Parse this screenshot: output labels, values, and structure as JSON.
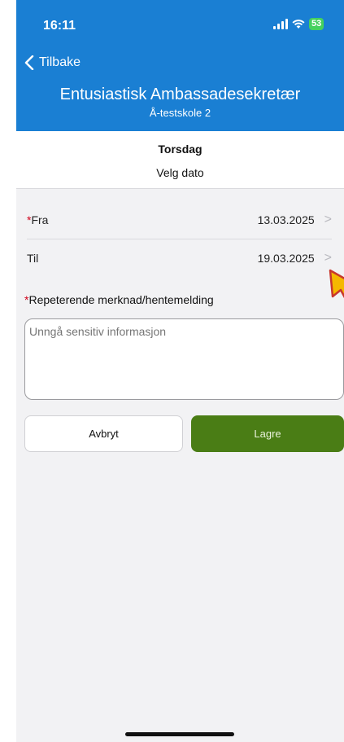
{
  "status_bar": {
    "time": "16:11",
    "battery": "53"
  },
  "header": {
    "back_label": "Tilbake",
    "title": "Entusiastisk Ambassadesekretær",
    "subtitle": "Å-testskole 2",
    "background_color": "#1a7fd3"
  },
  "date_section": {
    "day": "Torsdag",
    "pick_label": "Velg dato"
  },
  "form": {
    "from": {
      "required_marker": "*",
      "label": "Fra",
      "value": "13.03.2025"
    },
    "to": {
      "label": "Til",
      "value": "19.03.2025"
    },
    "note": {
      "required_marker": "*",
      "label": "Repeterende merknad/hentemelding",
      "placeholder": "Unngå sensitiv informasjon",
      "value": ""
    }
  },
  "buttons": {
    "cancel": "Avbryt",
    "save": "Lagre",
    "save_color": "#4a7d15"
  },
  "icons": {
    "back": "chevron-left-icon",
    "row_chevron": "chevron-right-icon",
    "pointer": "pointer-cursor-icon"
  }
}
